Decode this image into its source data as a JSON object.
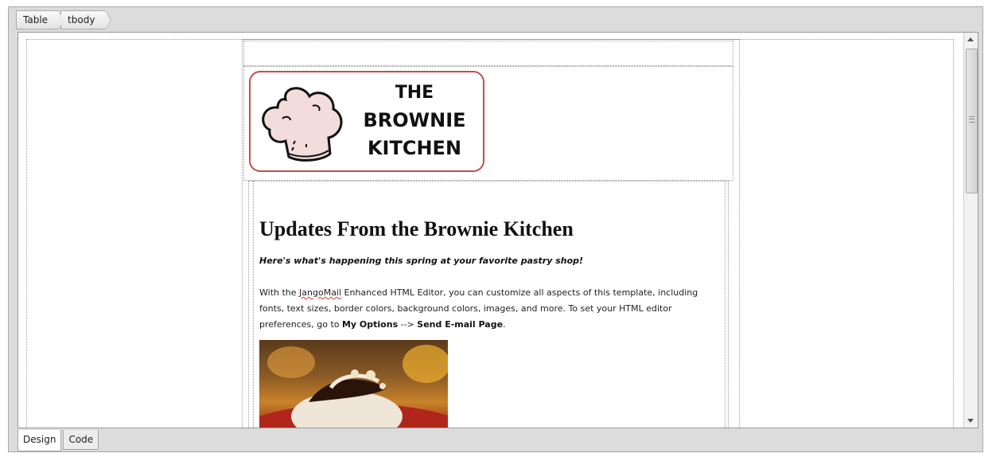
{
  "breadcrumb": [
    "Table",
    "tbody"
  ],
  "bottom_tabs": {
    "design": "Design",
    "code": "Code"
  },
  "logo": {
    "line1": "The",
    "line2": "Brownie",
    "line3": "Kitchen"
  },
  "content": {
    "headline": "Updates From the Brownie Kitchen",
    "subhead": "Here's what's happening this spring at your favorite pastry shop!",
    "body_part1": "With the ",
    "body_misspelled": "JangoMail",
    "body_part2": " Enhanced HTML Editor, you can customize all aspects of this template, including fonts, text sizes, border colors, background colors, images, and more. To set your HTML editor preferences, go to ",
    "body_bold1": "My Options",
    "body_arrow": " --> ",
    "body_bold2": "Send E-mail Page",
    "body_end": "."
  },
  "colors": {
    "logo_border": "#c0504d",
    "frame_bg": "#dcdcdc"
  },
  "icons": {
    "chef_hat": "chef-hat-icon",
    "scroll_grip": "grip-icon"
  }
}
